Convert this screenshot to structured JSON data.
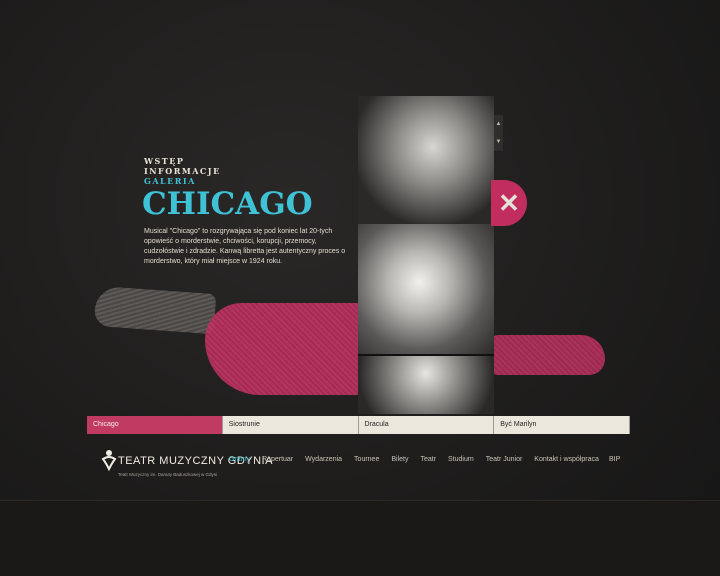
{
  "submenu": {
    "items": [
      "WSTĘP",
      "INFORMACJE",
      "GALERIA"
    ],
    "active_index": 2
  },
  "show": {
    "title": "CHICAGO",
    "description": "Musical \"Chicago\" to rozgrywająca się pod koniec lat 20-tych opowieść o morderstwie, chciwości, korupcji, przemocy, cudzołóstwie i zdradzie. Kanwą libretta jest autentyczny proces o morderstwo, który miał miejsce w 1924 roku."
  },
  "gallery": {
    "scroll_up_icon": "triangle-up-icon",
    "scroll_down_icon": "triangle-down-icon",
    "close_icon": "close-x-icon",
    "close_symbol": "✕",
    "photos": [
      "photo-1",
      "photo-2",
      "photo-3"
    ]
  },
  "tabs": {
    "items": [
      "Chicago",
      "Siostrunie",
      "Dracula",
      "Być Marilyn"
    ],
    "active_index": 0
  },
  "logo": {
    "name": "TEATR MUZYCZNY GDYNIA",
    "subtitle": "Teatr Muzyczny im. Danuty Baduszkowej w Gdyni"
  },
  "nav": {
    "items": [
      "Gramy",
      "Repertuar",
      "Wydarzenia",
      "Tournee",
      "Bilety",
      "Teatr",
      "Studium",
      "Teatr Junior",
      "Kontakt i współpraca"
    ],
    "active_index": 0,
    "bip": "BIP"
  },
  "colors": {
    "accent": "#3fc2d6",
    "highlight": "#c03a62",
    "background": "#1c1b1a"
  }
}
